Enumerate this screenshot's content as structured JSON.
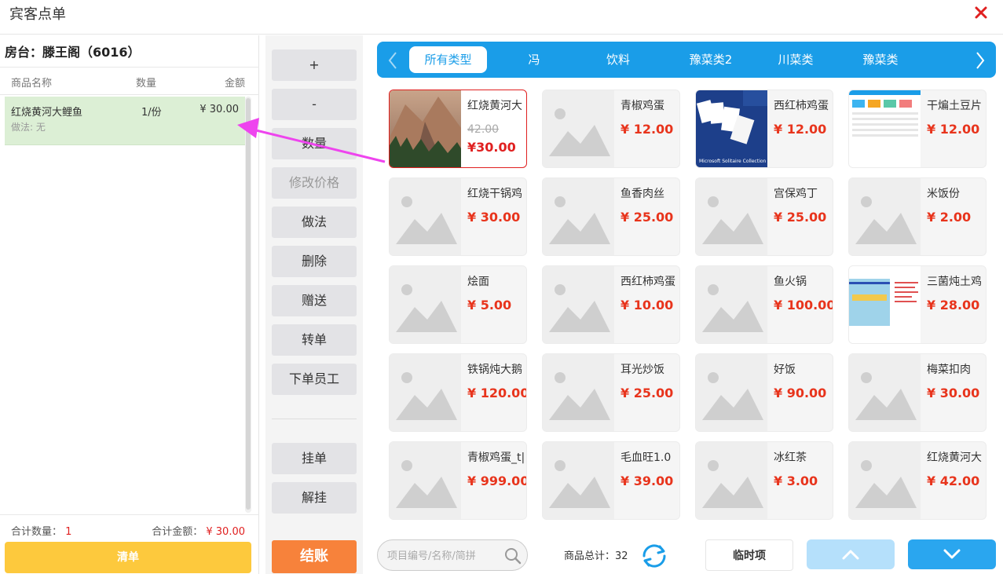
{
  "window": {
    "title": "宾客点单"
  },
  "room": {
    "label": "房台：",
    "value": "滕王阁（6016）"
  },
  "order_table": {
    "columns": [
      "商品名称",
      "数量",
      "金额"
    ],
    "rows": [
      {
        "name": "红烧黄河大鲤鱼",
        "qty": "1/份",
        "amount": "¥ 30.00",
        "method": "做法: 无"
      }
    ]
  },
  "totals": {
    "qty_label": "合计数量：",
    "qty_value": "1",
    "amount_label": "合计金额：",
    "amount_value": "¥ 30.00"
  },
  "clear_label": "清单",
  "actions": [
    "+",
    "-",
    "数量",
    "修改价格",
    "做法",
    "删除",
    "赠送",
    "转单",
    "下单员工"
  ],
  "actions_lower": [
    "挂单",
    "解挂"
  ],
  "checkout_label": "结账",
  "categories": [
    "所有类型",
    "冯",
    "饮料",
    "豫菜类2",
    "川菜类",
    "豫菜类"
  ],
  "active_category": "所有类型",
  "products": [
    {
      "name": "红烧黄河大",
      "old_price": "42.00",
      "price": "¥30.00",
      "thumb": "mountain-photo",
      "selected": true
    },
    {
      "name": "青椒鸡蛋",
      "price": "¥ 12.00",
      "thumb": "placeholder-image"
    },
    {
      "name": "西红柿鸡蛋",
      "price": "¥ 12.00",
      "thumb": "solitaire-screenshot"
    },
    {
      "name": "干煸土豆片",
      "price": "¥ 12.00",
      "thumb": "dashboard-screenshot"
    },
    {
      "name": "红烧干锅鸡",
      "price": "¥ 30.00",
      "thumb": "placeholder-image"
    },
    {
      "name": "鱼香肉丝",
      "price": "¥ 25.00",
      "thumb": "placeholder-image"
    },
    {
      "name": "宫保鸡丁",
      "price": "¥ 25.00",
      "thumb": "placeholder-image"
    },
    {
      "name": "米饭份",
      "price": "¥ 2.00",
      "thumb": "placeholder-image"
    },
    {
      "name": "烩面",
      "price": "¥ 5.00",
      "thumb": "placeholder-image"
    },
    {
      "name": "西红柿鸡蛋",
      "price": "¥ 10.00",
      "thumb": "placeholder-image"
    },
    {
      "name": "鱼火锅",
      "price": "¥ 100.00",
      "thumb": "placeholder-image"
    },
    {
      "name": "三菌炖土鸡",
      "price": "¥ 28.00",
      "thumb": "form-screenshot"
    },
    {
      "name": "铁锅炖大鹅",
      "price": "¥ 120.00",
      "thumb": "placeholder-image"
    },
    {
      "name": "耳光炒饭",
      "price": "¥ 25.00",
      "thumb": "placeholder-image"
    },
    {
      "name": "好饭",
      "price": "¥ 90.00",
      "thumb": "placeholder-image"
    },
    {
      "name": "梅菜扣肉",
      "price": "¥ 30.00",
      "thumb": "placeholder-image"
    },
    {
      "name": "青椒鸡蛋_t|",
      "price": "¥ 999.00",
      "thumb": "placeholder-image"
    },
    {
      "name": "毛血旺1.0",
      "price": "¥ 39.00",
      "thumb": "placeholder-image"
    },
    {
      "name": "冰红茶",
      "price": "¥ 3.00",
      "thumb": "placeholder-image"
    },
    {
      "name": "红烧黄河大",
      "price": "¥ 42.00",
      "thumb": "placeholder-image"
    }
  ],
  "search": {
    "placeholder": "项目编号/名称/简拼",
    "value": ""
  },
  "product_total": "商品总计：32",
  "temp_item_label": "临时项",
  "colors": {
    "accent": "#1a9de8",
    "price": "#e8341c",
    "clear": "#fdc93d",
    "checkout": "#f7823b",
    "selected_row": "#dcefd5",
    "annotation_arrow": "#ee44ee"
  }
}
